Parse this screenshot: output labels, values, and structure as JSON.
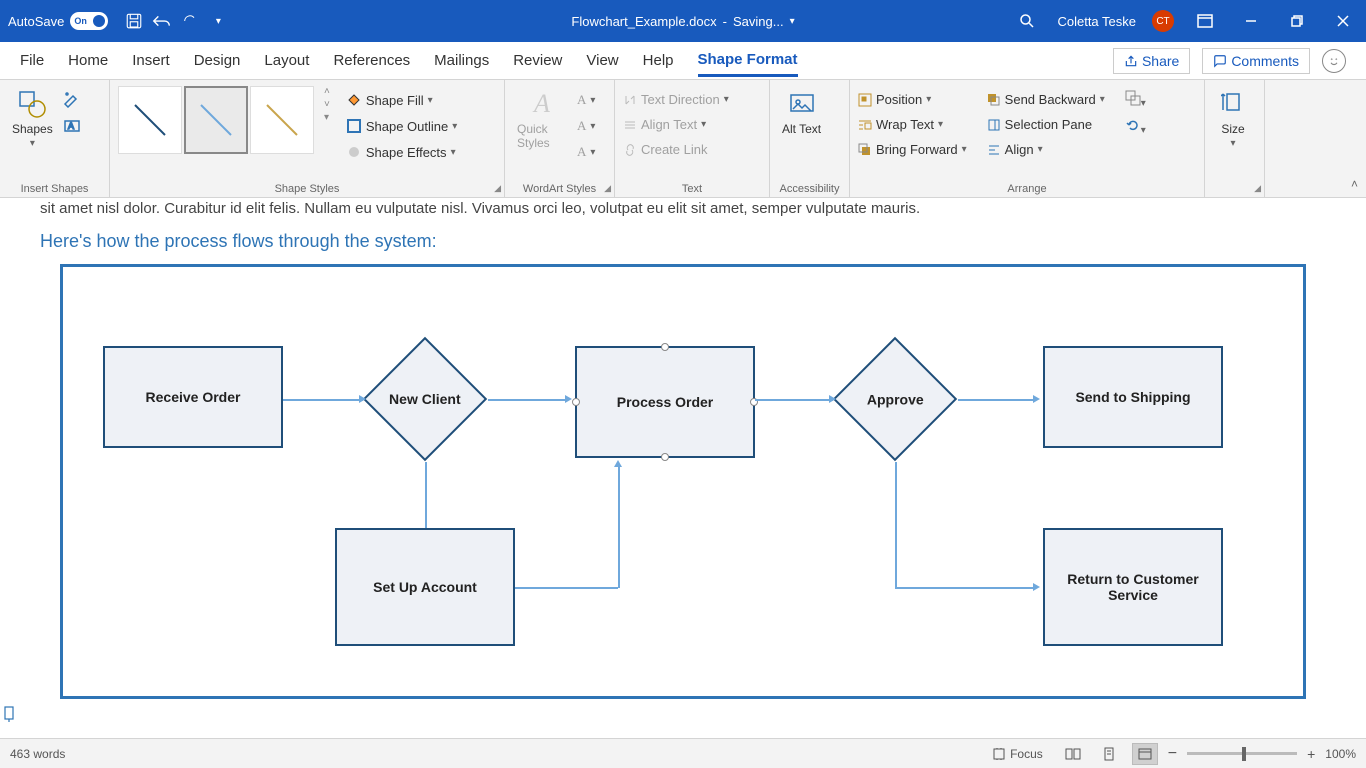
{
  "titlebar": {
    "autosave_label": "AutoSave",
    "autosave_state": "On",
    "document_name": "Flowchart_Example.docx",
    "saving_status": "Saving...",
    "user_name": "Coletta Teske",
    "user_initials": "CT"
  },
  "tabs": {
    "file": "File",
    "home": "Home",
    "insert": "Insert",
    "design": "Design",
    "layout": "Layout",
    "references": "References",
    "mailings": "Mailings",
    "review": "Review",
    "view": "View",
    "help": "Help",
    "shape_format": "Shape Format",
    "share": "Share",
    "comments": "Comments"
  },
  "ribbon": {
    "insert_shapes": {
      "shapes": "Shapes",
      "label": "Insert Shapes"
    },
    "shape_styles": {
      "fill": "Shape Fill",
      "outline": "Shape Outline",
      "effects": "Shape Effects",
      "label": "Shape Styles"
    },
    "wordart": {
      "quick": "Quick Styles",
      "label": "WordArt Styles"
    },
    "text": {
      "direction": "Text Direction",
      "align": "Align Text",
      "link": "Create Link",
      "label": "Text"
    },
    "accessibility": {
      "alt": "Alt Text",
      "label": "Accessibility"
    },
    "arrange": {
      "position": "Position",
      "wrap": "Wrap Text",
      "forward": "Bring Forward",
      "backward": "Send Backward",
      "selection": "Selection Pane",
      "align": "Align",
      "label": "Arrange"
    },
    "size": {
      "size": "Size",
      "label": ""
    }
  },
  "document": {
    "body_cut": "sit amet nisl dolor. Curabitur id elit felis. Nullam eu vulputate nisl. Vivamus orci leo, volutpat eu elit sit amet, semper vulputate mauris.",
    "heading": "Here's how the process flows through the system:",
    "flowchart": {
      "receive": "Receive Order",
      "new_client": "New Client",
      "process": "Process Order",
      "approve": "Approve",
      "shipping": "Send to Shipping",
      "setup": "Set Up Account",
      "return_cs": "Return to Customer Service"
    }
  },
  "statusbar": {
    "words": "463 words",
    "focus": "Focus",
    "zoom": "100%"
  }
}
